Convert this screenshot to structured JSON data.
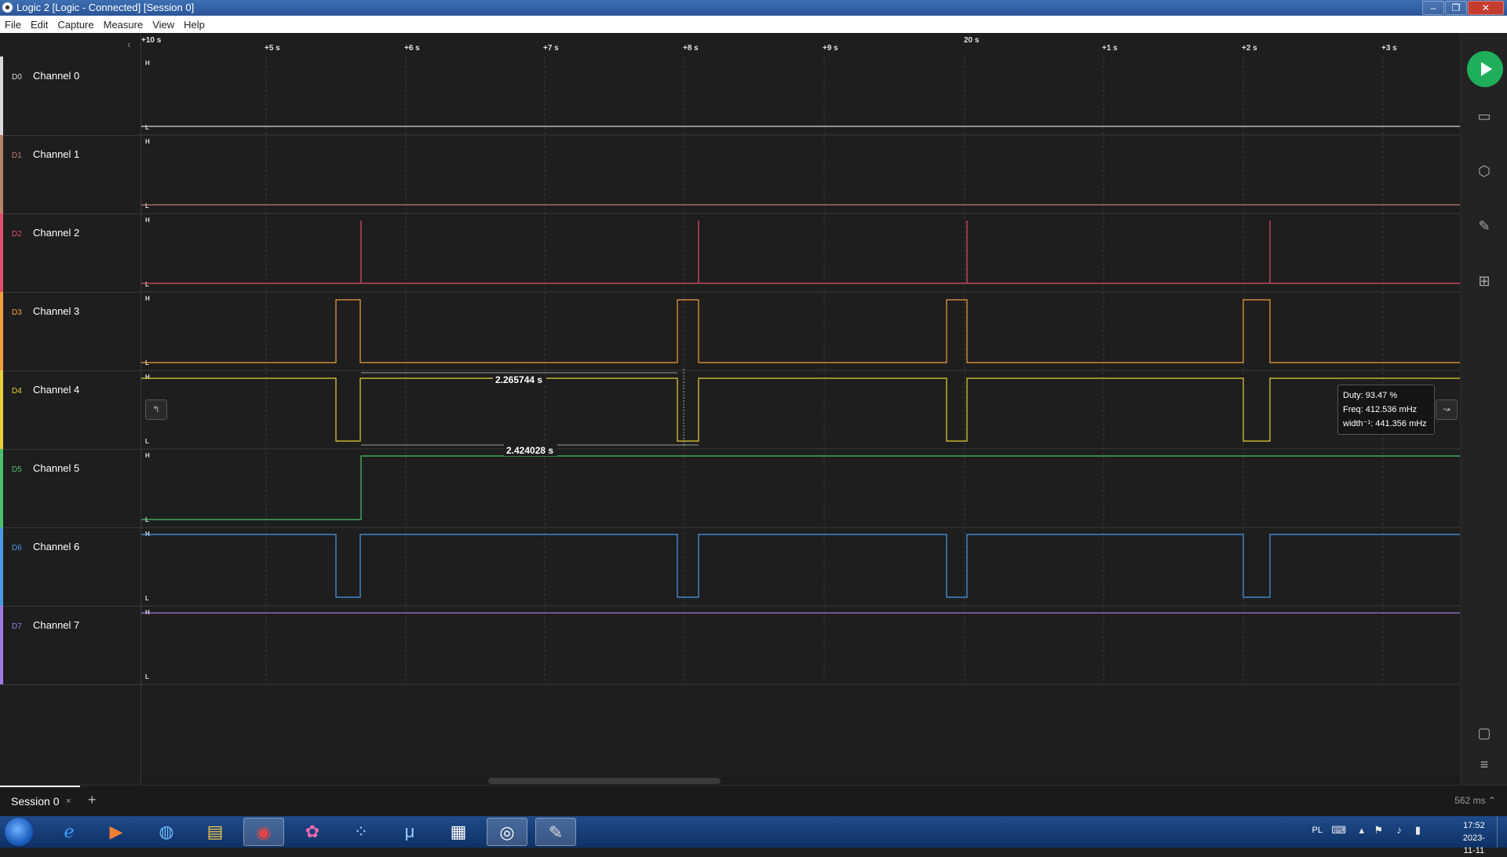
{
  "window": {
    "title": "Logic 2 [Logic - Connected] [Session 0]",
    "buttons": [
      "–",
      "❐",
      "✕"
    ]
  },
  "menu": [
    "File",
    "Edit",
    "Capture",
    "Measure",
    "View",
    "Help"
  ],
  "ruler": {
    "ticks": [
      "+10 s",
      "+5 s",
      "+6 s",
      "+7 s",
      "+8 s",
      "+9 s",
      "20 s",
      "+1 s",
      "+2 s",
      "+3 s"
    ]
  },
  "channels": [
    {
      "id": "D0",
      "name": "Channel 0",
      "color": "#d9d9d9",
      "high": "H",
      "low": "L"
    },
    {
      "id": "D1",
      "name": "Channel 1",
      "color": "#b8836b",
      "high": "H",
      "low": "L"
    },
    {
      "id": "D2",
      "name": "Channel 2",
      "color": "#e0506a",
      "high": "H",
      "low": "L"
    },
    {
      "id": "D3",
      "name": "Channel 3",
      "color": "#f0a040",
      "high": "H",
      "low": "L"
    },
    {
      "id": "D4",
      "name": "Channel 4",
      "color": "#e8cf3a",
      "high": "H",
      "low": "L"
    },
    {
      "id": "D5",
      "name": "Channel 5",
      "color": "#4cc06a",
      "high": "H",
      "low": "L"
    },
    {
      "id": "D6",
      "name": "Channel 6",
      "color": "#4a9ae8",
      "high": "H",
      "low": "L"
    },
    {
      "id": "D7",
      "name": "Channel 7",
      "color": "#a07ae0",
      "high": "H",
      "low": "L"
    }
  ],
  "timing_markers": {
    "period1": "2.265744 s",
    "period2": "2.424028 s"
  },
  "measurement": {
    "duty": "Duty: 93.47 %",
    "freq": "Freq: 412.536 mHz",
    "width": "width⁻¹: 441.356 mHz"
  },
  "session": {
    "tab_label": "Session 0",
    "close": "×",
    "add": "+",
    "status": "562 ms ⌃"
  },
  "taskbar": {
    "language": "PL",
    "time": "17:52",
    "date": "2023-11-11"
  }
}
